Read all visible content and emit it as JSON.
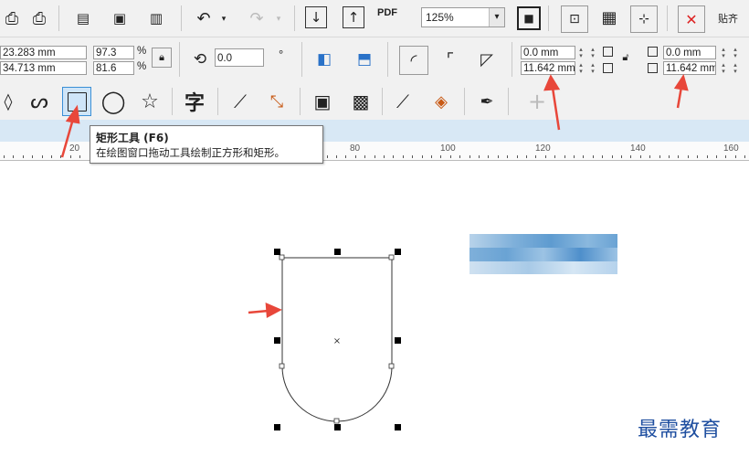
{
  "toolbar_top": {
    "pdf_label": "PDF",
    "zoom": {
      "value": "125%",
      "options_arrow": "▾"
    },
    "snap_label": "贴齐"
  },
  "property_bar": {
    "x_pos": "23.283 mm",
    "y_pos": "34.713 mm",
    "scale_w": "97.3",
    "scale_h": "81.6",
    "percent": "%",
    "rotation": "0.0",
    "degree": "°",
    "corner_radius_tl": "0.0 mm",
    "corner_radius_bl": "11.642 mm",
    "corner_radius_tr": "0.0 mm",
    "corner_radius_br": "11.642 mm"
  },
  "tooltip": {
    "title": "矩形工具 (F6)",
    "description": "在绘图窗口拖动工具绘制正方形和矩形。"
  },
  "ruler": {
    "labels": [
      "20",
      "80",
      "100",
      "120",
      "140",
      "160"
    ]
  },
  "watermark": "最需教育",
  "colors": {
    "accent_red": "#e8473a",
    "selection": "#3a8fd6",
    "toolbar_bg": "#f1f1f1"
  }
}
